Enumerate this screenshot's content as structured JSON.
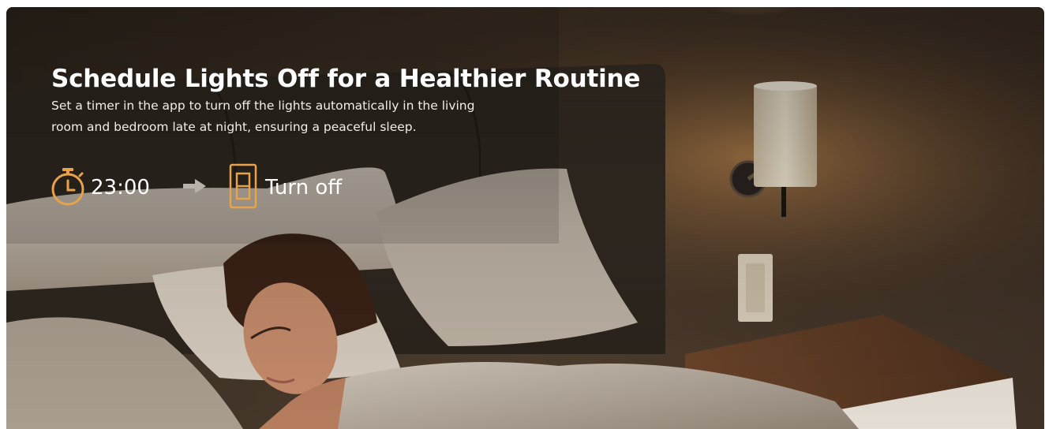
{
  "banner": {
    "title": "Schedule Lights Off for a Healthier Routine",
    "description": "Set a timer in the app to turn off the lights automatically in the living room and bedroom late at night, ensuring a peaceful sleep.",
    "schedule": {
      "time": "23:00",
      "time_icon": "timer-icon",
      "arrow_icon": "arrow-right-icon",
      "switch_icon": "light-switch-icon",
      "action": "Turn off"
    },
    "accent_color": "#e8a24a",
    "scene": {
      "subject": "woman-sleeping-icon",
      "lamp": "wall-lamp-icon",
      "wall_switch": "wall-switch-icon",
      "nightstand": "nightstand-icon"
    }
  }
}
